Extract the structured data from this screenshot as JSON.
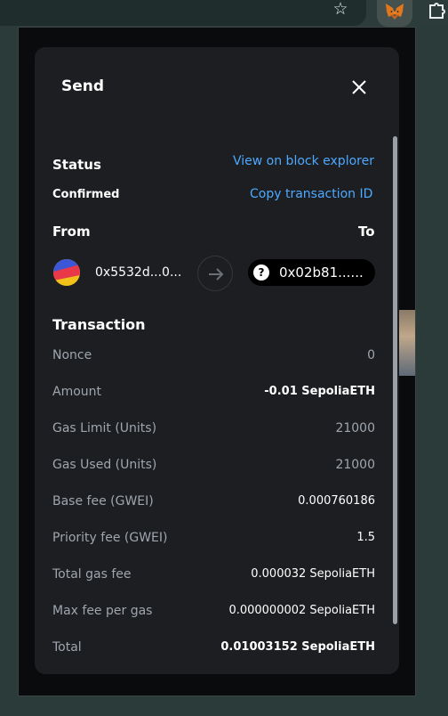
{
  "browser": {
    "star_icon": "star-icon",
    "extension_icon": "metamask-fox-icon",
    "puzzle_icon": "puzzle-icon"
  },
  "modal": {
    "title": "Send",
    "close_icon": "close-icon"
  },
  "status": {
    "label": "Status",
    "value": "Confirmed",
    "view_explorer_link": "View on block explorer",
    "copy_tx_link": "Copy transaction ID"
  },
  "parties": {
    "from_label": "From",
    "to_label": "To",
    "from_address": "0x5532d...0...",
    "to_address": "0x02b81......"
  },
  "transaction": {
    "heading": "Transaction",
    "rows": [
      {
        "label": "Nonce",
        "value": "0"
      },
      {
        "label": "Amount",
        "value": "-0.01 SepoliaETH"
      },
      {
        "label": "Gas Limit (Units)",
        "value": "21000"
      },
      {
        "label": "Gas Used (Units)",
        "value": "21000"
      },
      {
        "label": "Base fee (GWEI)",
        "value": "0.000760186"
      },
      {
        "label": "Priority fee (GWEI)",
        "value": "1.5"
      },
      {
        "label": "Total gas fee",
        "value": "0.000032 SepoliaETH"
      },
      {
        "label": "Max fee per gas",
        "value": "0.000000002 SepoliaETH"
      },
      {
        "label": "Total",
        "value": "0.01003152 SepoliaETH"
      }
    ]
  },
  "colors": {
    "link": "#4ea9ff",
    "modal_bg": "#1c1e21",
    "label_muted": "#9fa6ae"
  }
}
